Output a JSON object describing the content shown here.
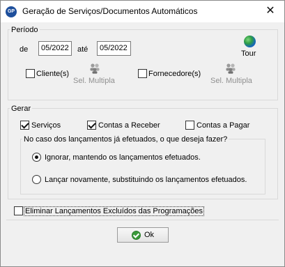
{
  "window": {
    "app_icon_text": "GP",
    "title": "Geração de Serviços/Documentos Automáticos",
    "close_glyph": "✕"
  },
  "periodo": {
    "legend": "Período",
    "de_label": "de",
    "de_value": "05/2022",
    "ate_label": "até",
    "ate_value": "05/2022",
    "tour_label": "Tour",
    "tour_icon": "globe-icon",
    "clientes_label": "Cliente(s)",
    "clientes_checked": false,
    "clientes_multi_label": "Sel. Multipla",
    "fornecedores_label": "Fornecedore(s)",
    "fornecedores_checked": false,
    "fornecedores_multi_label": "Sel. Multipla"
  },
  "gerar": {
    "legend": "Gerar",
    "servicos_label": "Serviços",
    "servicos_checked": true,
    "receber_label": "Contas a Receber",
    "receber_checked": true,
    "pagar_label": "Contas a Pagar",
    "pagar_checked": false,
    "question_legend": "No caso dos lançamentos já efetuados, o que deseja fazer?",
    "option_ignorar": "Ignorar, mantendo os lançamentos efetuados.",
    "option_lancar": "Lançar novamente, substituindo os lançamentos efetuados.",
    "selected_option": "ignorar"
  },
  "eliminar": {
    "label": "Eliminar Lançamentos Excluídos das Programações",
    "checked": false
  },
  "ok_button": {
    "label": "Ok"
  },
  "colors": {
    "dialog_bg": "#f0f0f0",
    "titlebar_bg": "#ffffff",
    "group_border": "#d9d9d9",
    "disabled_text": "#8f8f8f",
    "ok_icon": "#3a9a3a"
  }
}
